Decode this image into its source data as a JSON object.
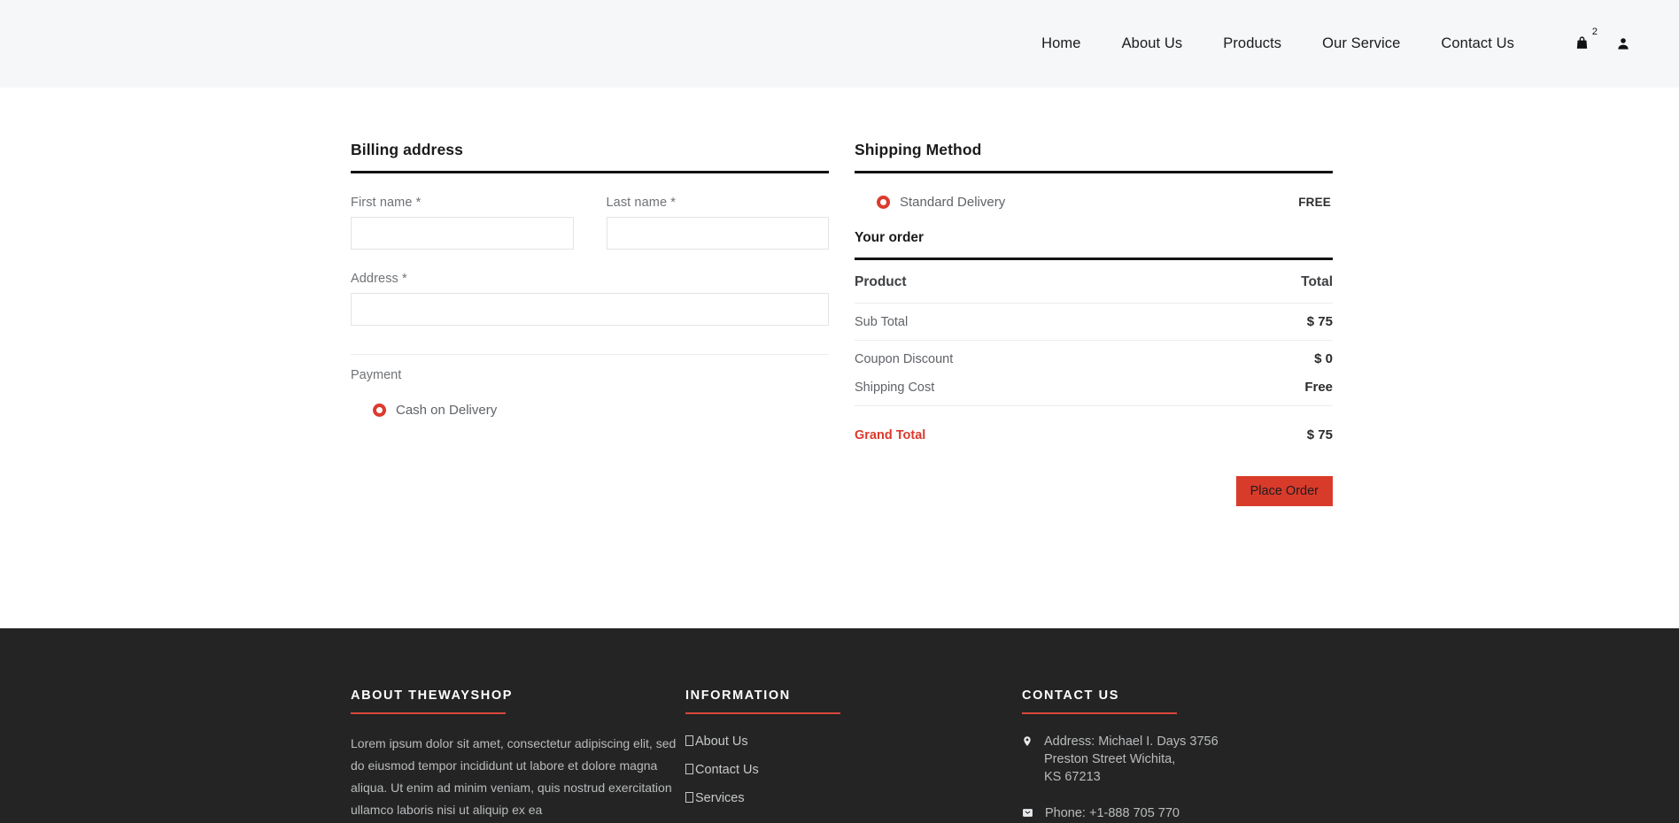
{
  "header": {
    "nav": [
      {
        "label": "Home"
      },
      {
        "label": "About Us"
      },
      {
        "label": "Products"
      },
      {
        "label": "Our Service"
      },
      {
        "label": "Contact Us"
      }
    ],
    "cart_icon": "shopping-bag-icon",
    "cart_count": "2",
    "account_icon": "user-icon"
  },
  "billing": {
    "title": "Billing address",
    "first_name": {
      "label": "First name *",
      "value": "",
      "placeholder": ""
    },
    "last_name": {
      "label": "Last name *",
      "value": "",
      "placeholder": ""
    },
    "address": {
      "label": "Address *",
      "value": "",
      "placeholder": ""
    },
    "payment_label": "Payment",
    "payment_option": "Cash on Delivery"
  },
  "shipping": {
    "title": "Shipping Method",
    "option_label": "Standard Delivery",
    "option_price": "FREE"
  },
  "order": {
    "title": "Your order",
    "columns": {
      "product": "Product",
      "total": "Total"
    },
    "rows": [
      {
        "label": "Sub Total",
        "value": "$ 75"
      },
      {
        "label": "Coupon Discount",
        "value": "$ 0"
      },
      {
        "label": "Shipping Cost",
        "value": "Free"
      }
    ],
    "grand_total": {
      "label": "Grand Total",
      "value": "$ 75"
    },
    "place_order": "Place Order"
  },
  "footer": {
    "about": {
      "title": "About Thewayshop",
      "text": "Lorem ipsum dolor sit amet, consectetur adipiscing elit, sed do eiusmod tempor incididunt ut labore et dolore magna aliqua. Ut enim ad minim veniam, quis nostrud exercitation ullamco laboris nisi ut aliquip ex ea"
    },
    "information": {
      "title": "Information",
      "links": [
        {
          "label": "About Us"
        },
        {
          "label": "Contact Us"
        },
        {
          "label": "Services"
        }
      ]
    },
    "contact": {
      "title": "Contact Us",
      "address_icon": "map-pin-icon",
      "address": "Address: Michael I. Days 3756 Preston Street Wichita, KS 67213",
      "address_lines": [
        "Address: Michael I. Days 3756",
        "Preston Street Wichita,",
        "KS 67213"
      ],
      "phone_icon": "phone-icon",
      "phone": "Phone: +1-888 705 770"
    }
  },
  "colors": {
    "accent_red": "#d93b2b",
    "header_bg": "#f6f7f9",
    "footer_bg": "#242424",
    "label_grey": "#6f7276"
  }
}
